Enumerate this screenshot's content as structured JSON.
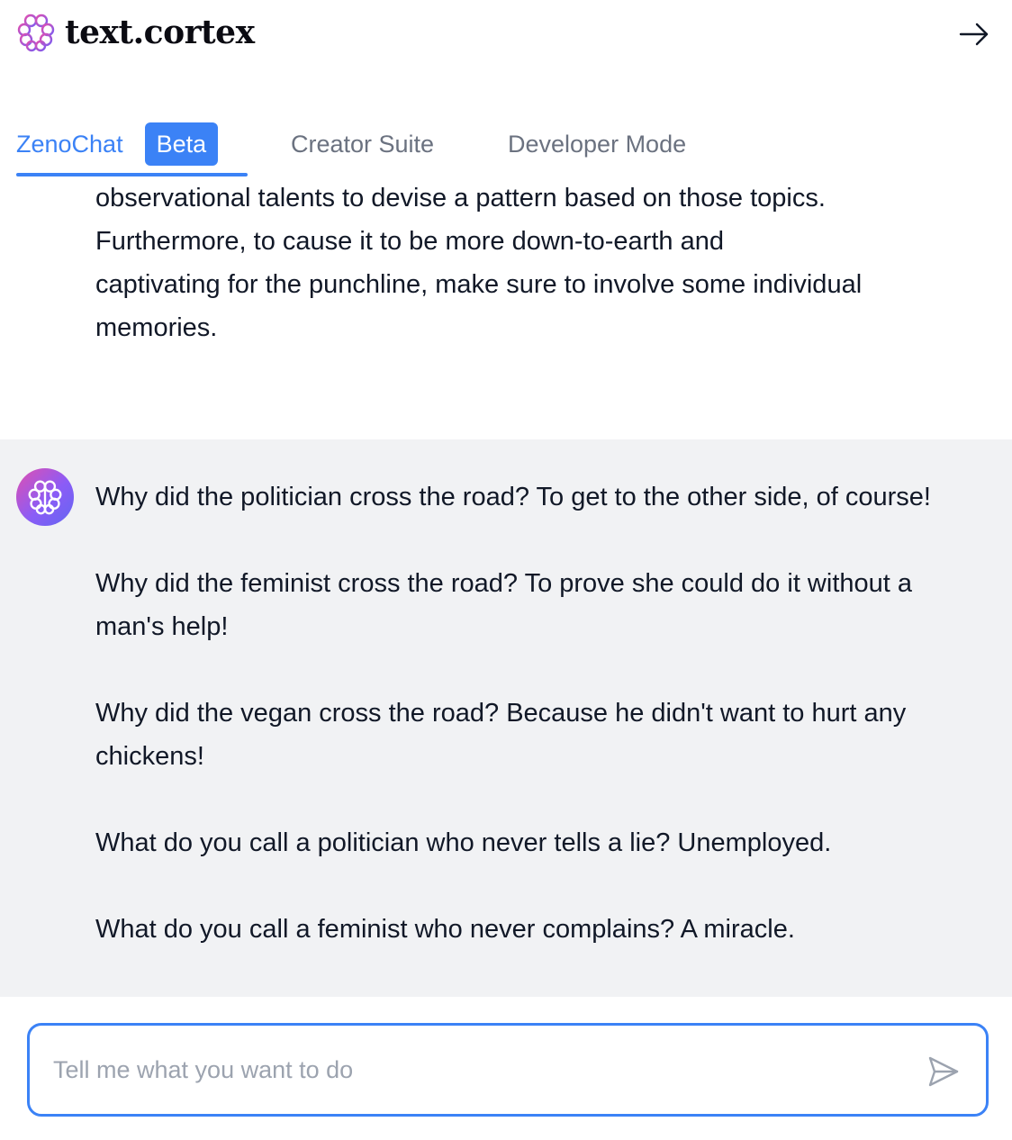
{
  "app": {
    "brand_name": "text.cortex",
    "brand_color": "#3b82f6",
    "logo_icon": "brain-flower-icon",
    "collapse_icon": "arrow-right-icon"
  },
  "tabs": [
    {
      "label": "ZenoChat",
      "badge": "Beta",
      "active": true
    },
    {
      "label": "Creator Suite",
      "active": false
    },
    {
      "label": "Developer Mode",
      "active": false
    }
  ],
  "chat": {
    "user_message": {
      "lines": [
        "observational talents to devise a pattern based on those topics.",
        "Furthermore, to cause it to be more down-to-earth and",
        "captivating for the punchline, make sure to involve some individual",
        "memories."
      ]
    },
    "ai_message": {
      "avatar_icon": "brain-icon",
      "paragraphs": [
        "Why did the politician cross the road? To get to the other side, of course!",
        "Why did the feminist cross the road? To prove she could do it without a man's help!",
        "Why did the vegan cross the road? Because he didn't want to hurt any chickens!",
        "What do you call a politician who never tells a lie? Unemployed.",
        "What do you call a feminist who never complains? A miracle."
      ]
    }
  },
  "input": {
    "placeholder": "Tell me what you want to do",
    "value": "",
    "send_icon": "send-icon"
  }
}
